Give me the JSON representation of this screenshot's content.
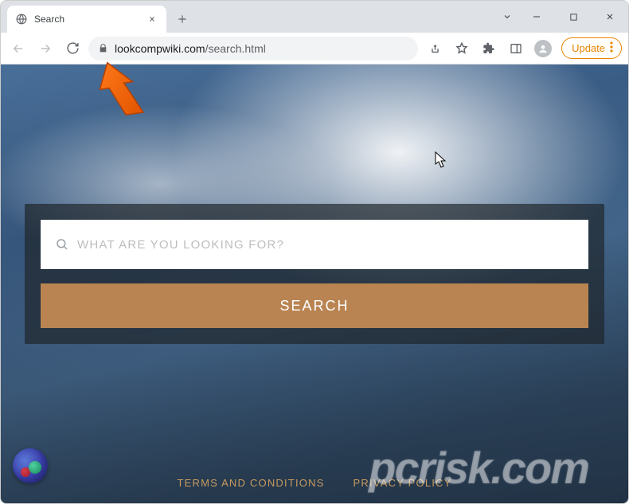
{
  "window": {
    "tab_title": "Search",
    "update_label": "Update"
  },
  "addressbar": {
    "domain": "lookcompwiki.com",
    "path": "/search.html"
  },
  "page": {
    "search_placeholder": "WHAT ARE YOU LOOKING FOR?",
    "search_button": "SEARCH",
    "footer": {
      "terms": "TERMS AND CONDITIONS",
      "privacy": "PRIVACY POLICY"
    }
  },
  "watermark": {
    "text_prefix": "pcrisk",
    "text_suffix": ".com"
  }
}
